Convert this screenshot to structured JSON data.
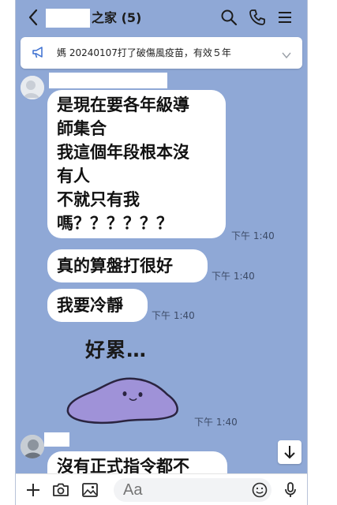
{
  "header": {
    "title": "之家 (5)",
    "icons": [
      "back-icon",
      "search-icon",
      "phone-icon",
      "menu-icon"
    ]
  },
  "announcement": {
    "text": "媽 20240107打了破傷風疫苗，有效５年",
    "icons": [
      "megaphone-icon",
      "chevron-down-icon"
    ]
  },
  "messages": [
    {
      "lines": [
        "是現在要各年級導",
        "師集合",
        "我這個年段根本沒",
        "有人",
        "不就只有我",
        "嗎？？？？？？"
      ],
      "time": "下午 1:40"
    },
    {
      "text": "真的算盤打很好",
      "time": "下午 1:40"
    },
    {
      "text": "我要冷靜",
      "time": "下午 1:40"
    },
    {
      "sticker_text": "好累…",
      "time": "下午 1:40",
      "sticker_icon": "purple-blob-sticker"
    },
    {
      "partial_text": "沒有正式指令都不"
    }
  ],
  "input": {
    "placeholder": "Aa",
    "icons": [
      "plus-icon",
      "camera-icon",
      "image-icon",
      "emoji-icon",
      "mic-icon"
    ]
  },
  "colors": {
    "chat_bg": "#8fa8d6",
    "bubble": "#ffffff",
    "sticker": "#9f92d8"
  }
}
